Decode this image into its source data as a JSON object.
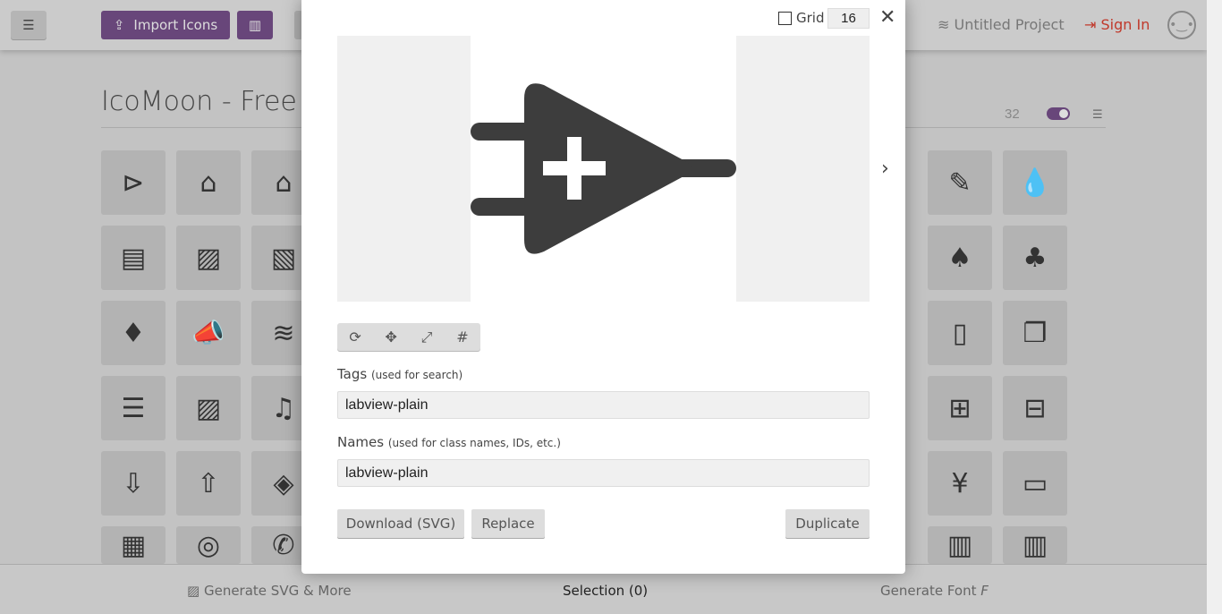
{
  "topbar": {
    "import_label": "Import Icons",
    "project": "Untitled Project",
    "signin": "Sign In"
  },
  "main": {
    "title": "IcoMoon - Free",
    "icon_size": "32"
  },
  "grid_left": [
    "⊳",
    "⌂",
    "⌂",
    "▤",
    "▨",
    "▧",
    "♦",
    "📣",
    "≋",
    "☰",
    "▨",
    "♫",
    "⇩",
    "⇧",
    "◈",
    "▦",
    "◎",
    "✆"
  ],
  "grid_right": [
    "✎",
    "💧",
    "♠",
    "♣",
    "▯",
    "❐",
    "⊞",
    "⊟",
    "¥",
    "▭",
    "▥",
    "▥"
  ],
  "footer": {
    "generate_svg": "Generate SVG & More",
    "selection": "Selection (0)",
    "generate_font": "Generate Font"
  },
  "modal": {
    "grid_label": "Grid",
    "grid_value": "16",
    "tags_label": "Tags",
    "tags_hint": "(used for search)",
    "tags_value": "labview-plain",
    "names_label": "Names",
    "names_hint": "(used for class names, IDs, etc.)",
    "names_value": "labview-plain",
    "download": "Download (SVG)",
    "replace": "Replace",
    "duplicate": "Duplicate"
  },
  "colors": {
    "accent": "#68467a",
    "signin": "#c0392b"
  }
}
